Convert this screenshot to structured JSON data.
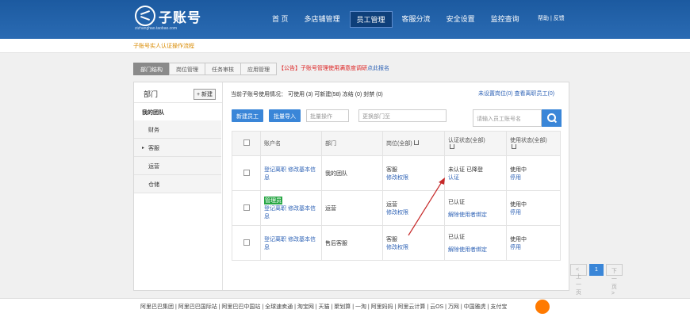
{
  "app": {
    "logo_text": "子账号",
    "logo_sub": "zizhanghao.taobao.com"
  },
  "nav": [
    "首 页",
    "多店铺管理",
    "员工管理",
    "客服分流",
    "安全设置",
    "监控查询"
  ],
  "top_links": "帮助 | 反馈",
  "notice": "子账号实人认证操作流程",
  "tabs": [
    "部门结构",
    "岗位管理",
    "任务审核",
    "应用管理"
  ],
  "announcement": {
    "prefix": "【公告】子账号管理使用满意度调研",
    "link": "点此报名"
  },
  "left": {
    "title": "部门",
    "new_button": "+ 新建",
    "team": "我的团队",
    "depts": [
      "财务",
      "客服",
      "运营",
      "仓储"
    ]
  },
  "status_line": "当前子账号使用情况： 可使用 (3)    可新建(58)    冻结 (0)    封禁 (0)",
  "right_links": "未设置岗位(0)    查看离职员工(0)",
  "buttons": {
    "new_staff": "新建员工",
    "batch_import": "批量导入"
  },
  "selects": {
    "batch": "批量操作",
    "dept": "更换部门至"
  },
  "search_placeholder": "请输入员工账号名",
  "table": {
    "headers": [
      "",
      "账户名",
      "部门",
      "岗位(全部)",
      "认证状态(全部)",
      "使用状态(全部)"
    ],
    "rows": [
      {
        "badge": "",
        "account": "登记离职 修改基本信息",
        "dept": "我的团队",
        "role": "客服",
        "role_link": "修改权限",
        "auth": "未认证 已降登",
        "auth_link": "认证",
        "use": "使用中",
        "use_link": "停用"
      },
      {
        "badge": "管理员",
        "account": "登记离职 修改基本信息",
        "dept": "运营",
        "role": "运营",
        "role_link": "修改权限",
        "auth": "已认证",
        "auth_link": "解除使用者绑定",
        "use": "使用中",
        "use_link": "停用"
      },
      {
        "badge": "",
        "account": "登记离职 修改基本信息",
        "dept": "售后客服",
        "role": "客服",
        "role_link": "修改权限",
        "auth": "已认证",
        "auth_link": "解除使用者绑定",
        "use": "使用中",
        "use_link": "停用"
      }
    ]
  },
  "pager": {
    "prev": "< 上一页",
    "current": "1",
    "next": "下一页 >"
  },
  "footer": "阿里巴巴集团 | 阿里巴巴国际站 | 阿里巴巴中国站 | 全球速卖通 | 淘宝网 | 天猫 | 聚划算 | 一淘 | 阿里妈妈 | 阿里云计算 | 云OS | 万网 | 中国雅虎 | 支付宝"
}
